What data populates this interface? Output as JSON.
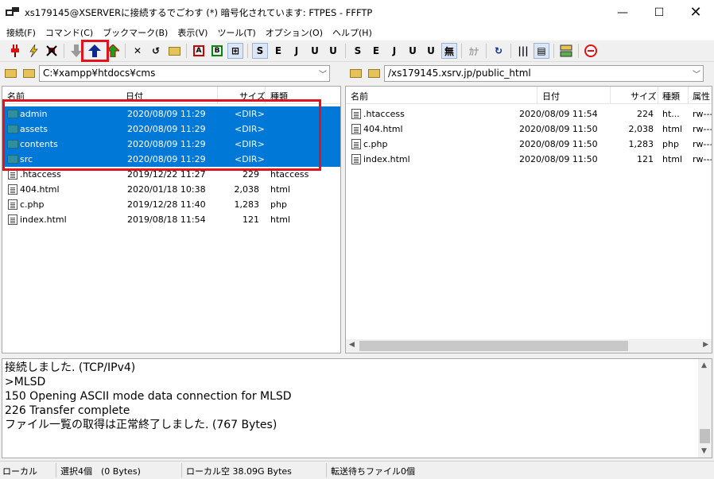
{
  "window": {
    "title": "xs179145@XSERVERに接続するでごわす (*) 暗号化されています: FTPES - FFFTP",
    "minimize": "—",
    "maximize": "☐",
    "close": "✕"
  },
  "menu": [
    "接続(F)",
    "コマンド(C)",
    "ブックマーク(B)",
    "表示(V)",
    "ツール(T)",
    "オプション(O)",
    "ヘルプ(H)"
  ],
  "toolbar": {
    "connect_icon": "plug-icon",
    "quick_connect_icon": "lightning-icon",
    "disconnect_icon": "disconnect-icon",
    "download_icon": "download-arrow-icon",
    "upload_icon": "upload-arrow-icon",
    "mirror_upload_icon": "mirror-upload-icon",
    "delete": "✕",
    "rename": "↺",
    "mkdir": "📁",
    "ascii": "A",
    "binary": "B",
    "auto": "⊞",
    "sjis": "S",
    "euc": "E",
    "jis": "J",
    "utf8": "U",
    "utf8bom": "U",
    "r_sjis": "S",
    "r_euc": "E",
    "r_jis": "J",
    "r_utf8": "U",
    "r_utf8bom": "U",
    "nokanji": "無",
    "kana": "ｶﾅ",
    "refresh": "↻",
    "list_view": "|||",
    "detail_view": "▤",
    "sync_icon": "sync-icon",
    "stop_icon": "stop-icon"
  },
  "local": {
    "path": "C:¥xampp¥htdocs¥cms",
    "columns": [
      "名前",
      "日付",
      "サイズ",
      "種類"
    ],
    "rows": [
      {
        "name": "admin",
        "date": "2020/08/09 11:29",
        "size": "<DIR>",
        "type": "",
        "selected": true,
        "kind": "folder"
      },
      {
        "name": "assets",
        "date": "2020/08/09 11:29",
        "size": "<DIR>",
        "type": "",
        "selected": true,
        "kind": "folder"
      },
      {
        "name": "contents",
        "date": "2020/08/09 11:29",
        "size": "<DIR>",
        "type": "",
        "selected": true,
        "kind": "folder"
      },
      {
        "name": "src",
        "date": "2020/08/09 11:29",
        "size": "<DIR>",
        "type": "",
        "selected": true,
        "kind": "folder"
      },
      {
        "name": ".htaccess",
        "date": "2019/12/22 11:27",
        "size": "229",
        "type": "htaccess",
        "selected": false,
        "kind": "file"
      },
      {
        "name": "404.html",
        "date": "2020/01/18 10:38",
        "size": "2,038",
        "type": "html",
        "selected": false,
        "kind": "file"
      },
      {
        "name": "c.php",
        "date": "2019/12/28 11:40",
        "size": "1,283",
        "type": "php",
        "selected": false,
        "kind": "file"
      },
      {
        "name": "index.html",
        "date": "2019/08/18 11:54",
        "size": "121",
        "type": "html",
        "selected": false,
        "kind": "file"
      }
    ]
  },
  "remote": {
    "path": "/xs179145.xsrv.jp/public_html",
    "columns": [
      "名前",
      "日付",
      "サイズ",
      "種類",
      "属性"
    ],
    "rows": [
      {
        "name": ".htaccess",
        "date": "2020/08/09 11:54",
        "size": "224",
        "type": "ht...",
        "attr": "rw---"
      },
      {
        "name": "404.html",
        "date": "2020/08/09 11:50",
        "size": "2,038",
        "type": "html",
        "attr": "rw---"
      },
      {
        "name": "c.php",
        "date": "2020/08/09 11:50",
        "size": "1,283",
        "type": "php",
        "attr": "rw---"
      },
      {
        "name": "index.html",
        "date": "2020/08/09 11:50",
        "size": "121",
        "type": "html",
        "attr": "rw---"
      }
    ]
  },
  "log": [
    "接続しました. (TCP/IPv4)",
    ">MLSD",
    "150 Opening ASCII mode data connection for MLSD",
    "226 Transfer complete",
    "ファイル一覧の取得は正常終了しました. (767 Bytes)"
  ],
  "status": {
    "local": "ローカル",
    "selection": "選択4個　(0 Bytes)",
    "free": "ローカル空 38.09G Bytes",
    "queue": "転送待ちファイル0個"
  }
}
